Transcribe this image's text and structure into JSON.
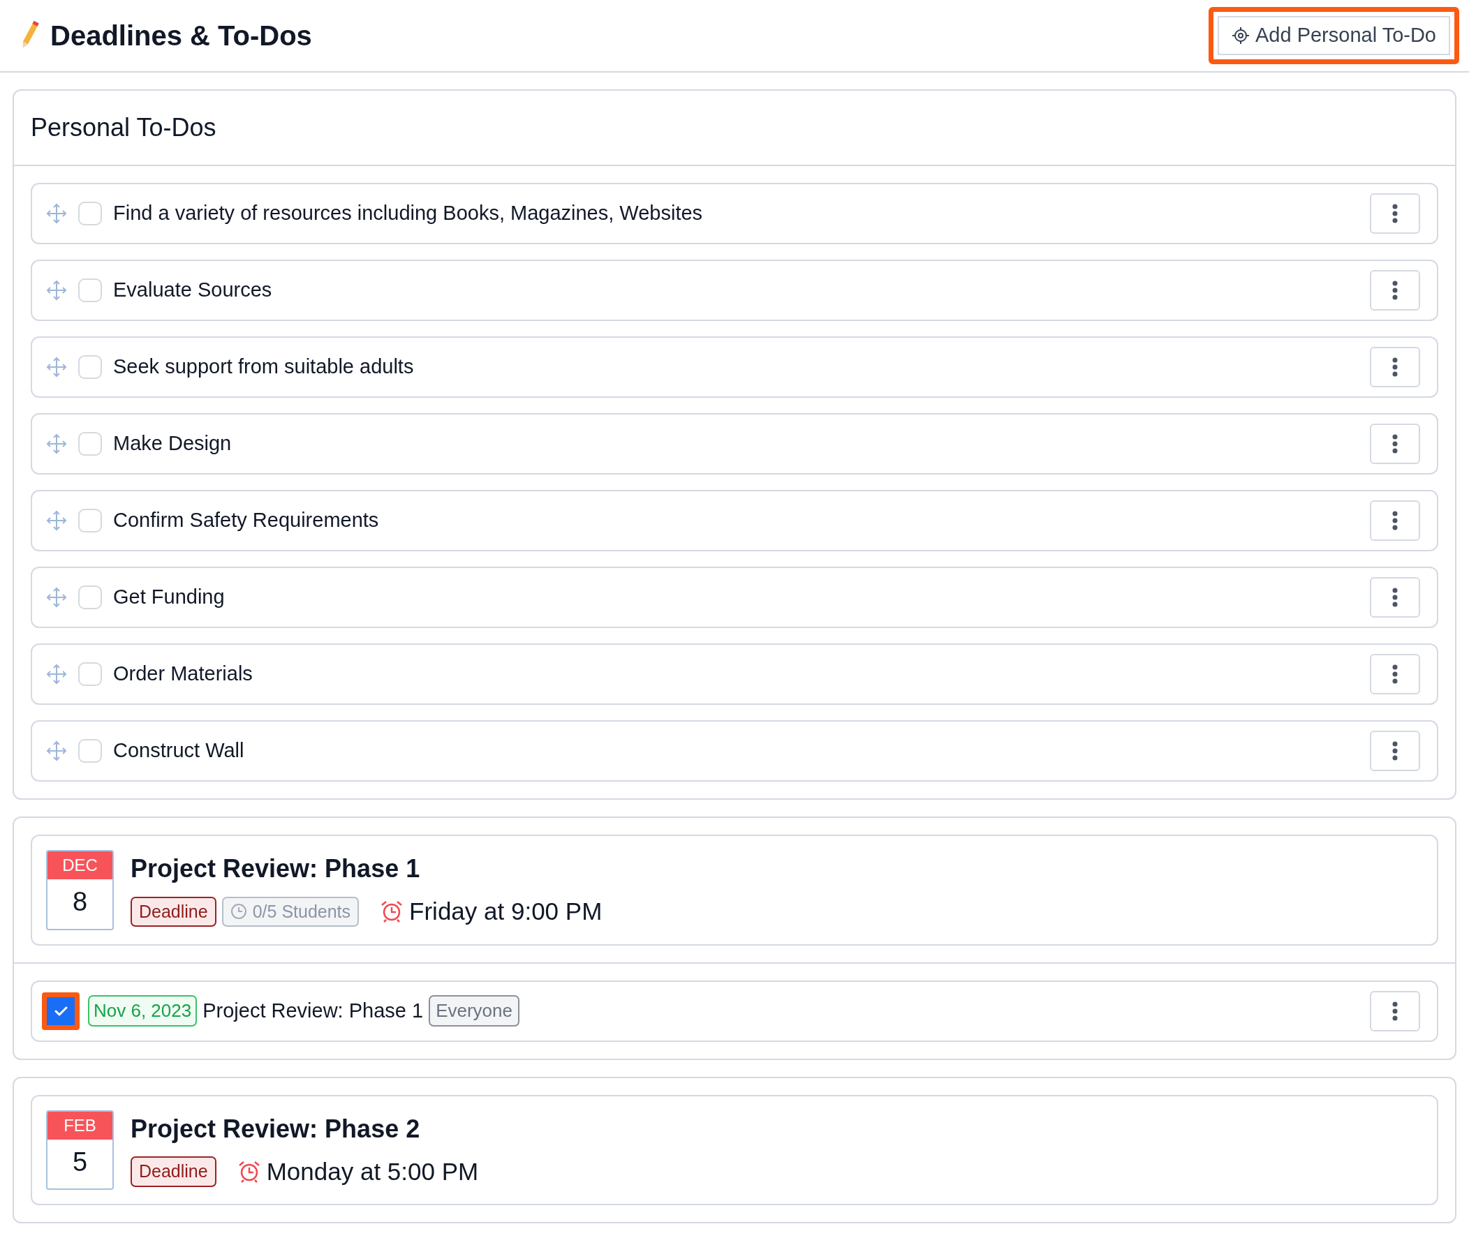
{
  "header": {
    "title": "Deadlines & To-Dos",
    "add_button": {
      "label": "Add Personal To-Do",
      "highlighted": true
    }
  },
  "personal_todos": {
    "title": "Personal To-Dos",
    "items": [
      {
        "text": "Find a variety of resources including Books, Magazines, Websites",
        "checked": false
      },
      {
        "text": "Evaluate Sources",
        "checked": false
      },
      {
        "text": "Seek support from suitable adults",
        "checked": false
      },
      {
        "text": "Make Design",
        "checked": false
      },
      {
        "text": "Confirm Safety Requirements",
        "checked": false
      },
      {
        "text": "Get Funding",
        "checked": false
      },
      {
        "text": "Order Materials",
        "checked": false
      },
      {
        "text": "Construct Wall",
        "checked": false
      }
    ]
  },
  "deadlines": [
    {
      "month": "DEC",
      "day": "8",
      "title": "Project Review: Phase 1",
      "type_label": "Deadline",
      "progress": "0/5 Students",
      "due": "Friday at 9:00 PM",
      "todos": [
        {
          "checked": true,
          "highlighted": true,
          "date": "Nov 6, 2023",
          "text": "Project Review: Phase 1",
          "audience": "Everyone"
        }
      ]
    },
    {
      "month": "FEB",
      "day": "5",
      "title": "Project Review: Phase 2",
      "type_label": "Deadline",
      "due": "Monday at 5:00 PM"
    }
  ]
}
